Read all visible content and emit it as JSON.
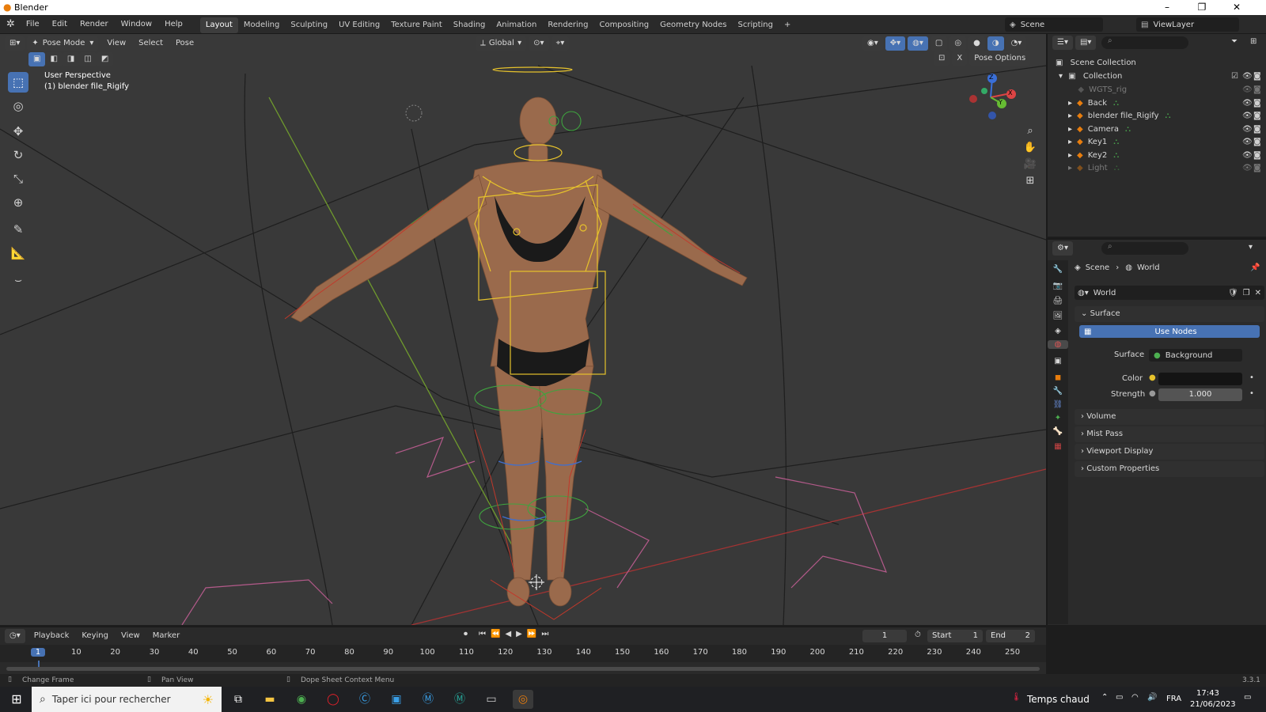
{
  "window": {
    "title": "Blender",
    "minimize": "–",
    "restore": "❐",
    "close": "✕"
  },
  "menu": {
    "file": "File",
    "edit": "Edit",
    "render": "Render",
    "window": "Window",
    "help": "Help"
  },
  "workspaces": [
    "Layout",
    "Modeling",
    "Sculpting",
    "UV Editing",
    "Texture Paint",
    "Shading",
    "Animation",
    "Rendering",
    "Compositing",
    "Geometry Nodes",
    "Scripting"
  ],
  "add_workspace": "+",
  "scene_selector": "Scene",
  "viewlayer_selector": "ViewLayer",
  "viewport": {
    "mode": "Pose Mode",
    "menus": {
      "view": "View",
      "select": "Select",
      "pose": "Pose"
    },
    "transform_orientation": "Global",
    "pose_options": "Pose Options",
    "x_label": "X",
    "perspective_label": "User Perspective",
    "object_label": "(1) blender file_Rigify",
    "gizmo": {
      "z": "Z",
      "y": "Y",
      "x": "X"
    }
  },
  "outliner": {
    "root": "Scene Collection",
    "collection": "Collection",
    "items": [
      {
        "name": "WGTS_rig",
        "disabled": true
      },
      {
        "name": "Back",
        "disabled": false
      },
      {
        "name": "blender file_Rigify",
        "disabled": false
      },
      {
        "name": "Camera",
        "disabled": false
      },
      {
        "name": "Key1",
        "disabled": false
      },
      {
        "name": "Key2",
        "disabled": false
      },
      {
        "name": "Light",
        "disabled": true
      }
    ]
  },
  "properties": {
    "breadcrumb_scene": "Scene",
    "breadcrumb_sep": "›",
    "breadcrumb_world": "World",
    "world_name": "World",
    "surface_panel": "Surface",
    "use_nodes": "Use Nodes",
    "surface_label": "Surface",
    "surface_value": "Background",
    "color_label": "Color",
    "strength_label": "Strength",
    "strength_value": "1.000",
    "collapsed_panels": [
      "Volume",
      "Mist Pass",
      "Viewport Display",
      "Custom Properties"
    ]
  },
  "timeline": {
    "menus": {
      "playback": "Playback",
      "keying": "Keying",
      "view": "View",
      "marker": "Marker"
    },
    "current_frame": "1",
    "start_label": "Start",
    "start_value": "1",
    "end_label": "End",
    "end_value": "2",
    "ruler": [
      "1",
      "10",
      "20",
      "30",
      "40",
      "50",
      "60",
      "70",
      "80",
      "90",
      "100",
      "110",
      "120",
      "130",
      "140",
      "150",
      "160",
      "170",
      "180",
      "190",
      "200",
      "210",
      "220",
      "230",
      "240",
      "250"
    ]
  },
  "statusbar": {
    "change_frame": "Change Frame",
    "pan_view": "Pan View",
    "context_menu": "Dope Sheet Context Menu",
    "version": "3.3.1"
  },
  "taskbar": {
    "search_placeholder": "Taper ici pour rechercher",
    "weather": "Temps chaud",
    "language": "FRA",
    "time": "17:43",
    "date": "21/06/2023"
  },
  "colors": {
    "accent": "#4772b3",
    "bone_yellow": "#e6c22c",
    "bone_green": "#3fa33f",
    "bone_red": "#c0392b",
    "pink_line": "#b35a8a"
  }
}
